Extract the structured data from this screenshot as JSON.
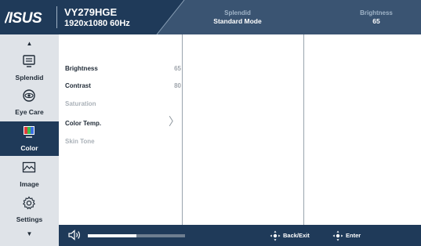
{
  "header": {
    "brand": "ASUS",
    "model": "VY279HGE",
    "resolution": "1920x1080 60Hz",
    "splendid_caption": "Splendid",
    "splendid_value": "Standard Mode",
    "brightness_caption": "Brightness",
    "brightness_value": "65"
  },
  "sidebar": {
    "items": [
      {
        "label": "Splendid",
        "icon": "monitor-icon"
      },
      {
        "label": "Eye Care",
        "icon": "eye-icon"
      },
      {
        "label": "Color",
        "icon": "color-bars-icon",
        "active": true
      },
      {
        "label": "Image",
        "icon": "image-icon"
      },
      {
        "label": "Settings",
        "icon": "gear-icon"
      }
    ],
    "up_arrow": "▲",
    "down_arrow": "▼"
  },
  "menu": {
    "items": [
      {
        "label": "Brightness",
        "value": "65",
        "enabled": true
      },
      {
        "label": "Contrast",
        "value": "80",
        "enabled": true
      },
      {
        "label": "Saturation",
        "value": "",
        "enabled": false
      },
      {
        "label": "Color Temp.",
        "value": "",
        "enabled": true,
        "submenu": true
      },
      {
        "label": "Skin Tone",
        "value": "",
        "enabled": false
      }
    ],
    "chevron": "〉"
  },
  "footer": {
    "volume_level": 0.5,
    "back_exit": "Back/Exit",
    "enter": "Enter"
  },
  "colors": {
    "primary_navy": "#1f3a59",
    "sidebar_bg": "#dfe3e8",
    "disabled_text": "#aab1b8",
    "value_text": "#a0a6ad"
  }
}
